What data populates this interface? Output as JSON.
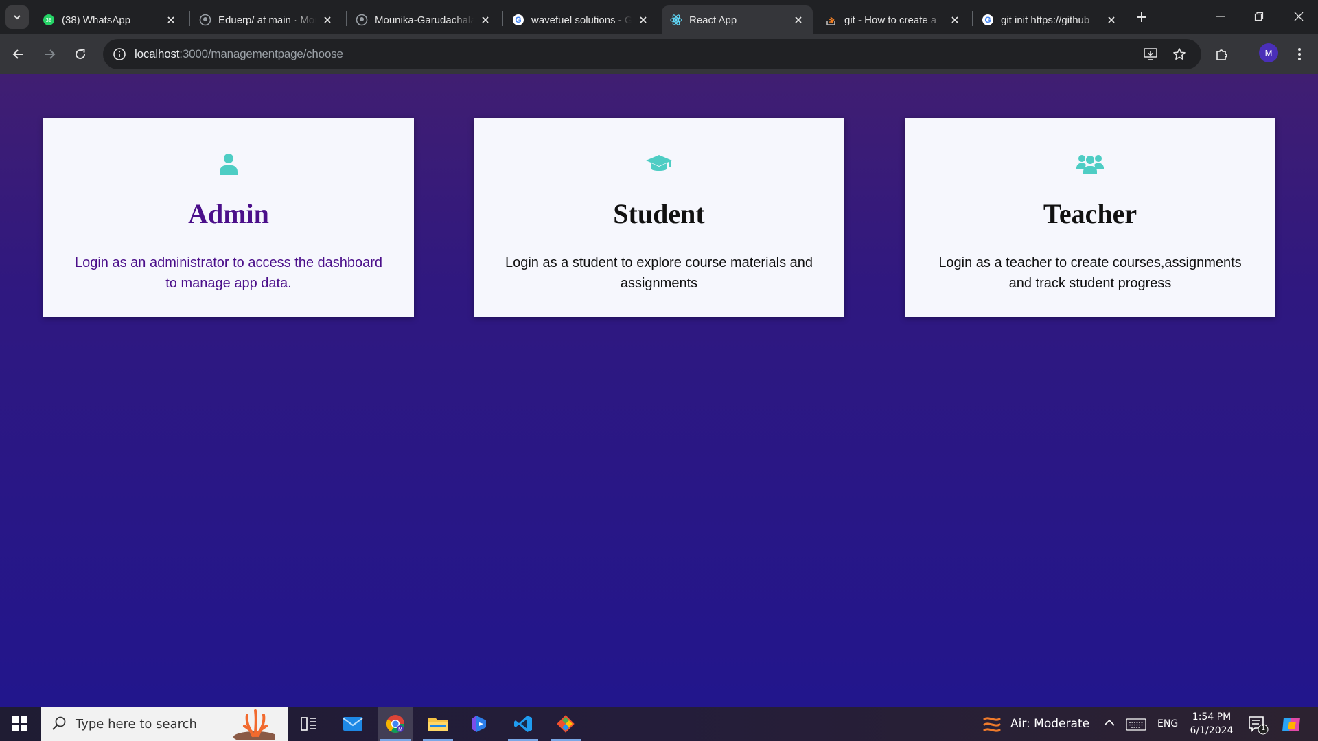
{
  "browser": {
    "tabs": [
      {
        "title": "(38) WhatsApp",
        "icon": "whatsapp-icon",
        "active": false
      },
      {
        "title": "Eduerp/ at main · Mounika",
        "icon": "github-icon",
        "active": false
      },
      {
        "title": "Mounika-Garudachalam",
        "icon": "github-icon",
        "active": false
      },
      {
        "title": "wavefuel solutions - Google",
        "icon": "google-icon",
        "active": false
      },
      {
        "title": "React App",
        "icon": "react-icon",
        "active": true
      },
      {
        "title": "git - How to create a",
        "icon": "stackoverflow-icon",
        "active": false
      },
      {
        "title": "git init https://github",
        "icon": "google-icon",
        "active": false
      }
    ],
    "url_host": "localhost",
    "url_path": ":3000/managementpage/choose",
    "profile_initial": "M"
  },
  "cards": [
    {
      "id": "admin",
      "icon": "user-icon",
      "title": "Admin",
      "description": "Login as an administrator to access the dashboard to manage app data."
    },
    {
      "id": "student",
      "icon": "graduation-cap-icon",
      "title": "Student",
      "description": "Login as a student to explore course materials and assignments"
    },
    {
      "id": "teacher",
      "icon": "users-icon",
      "title": "Teacher",
      "description": "Login as a teacher to create courses,assignments and track student progress"
    }
  ],
  "colors": {
    "accent_icon": "#4ecdc4",
    "admin_text": "#4b0f8a"
  },
  "taskbar": {
    "search_placeholder": "Type here to search",
    "weather": "Air: Moderate",
    "language": "ENG",
    "time": "1:54 PM",
    "date": "6/1/2024",
    "notification_count": "1"
  }
}
